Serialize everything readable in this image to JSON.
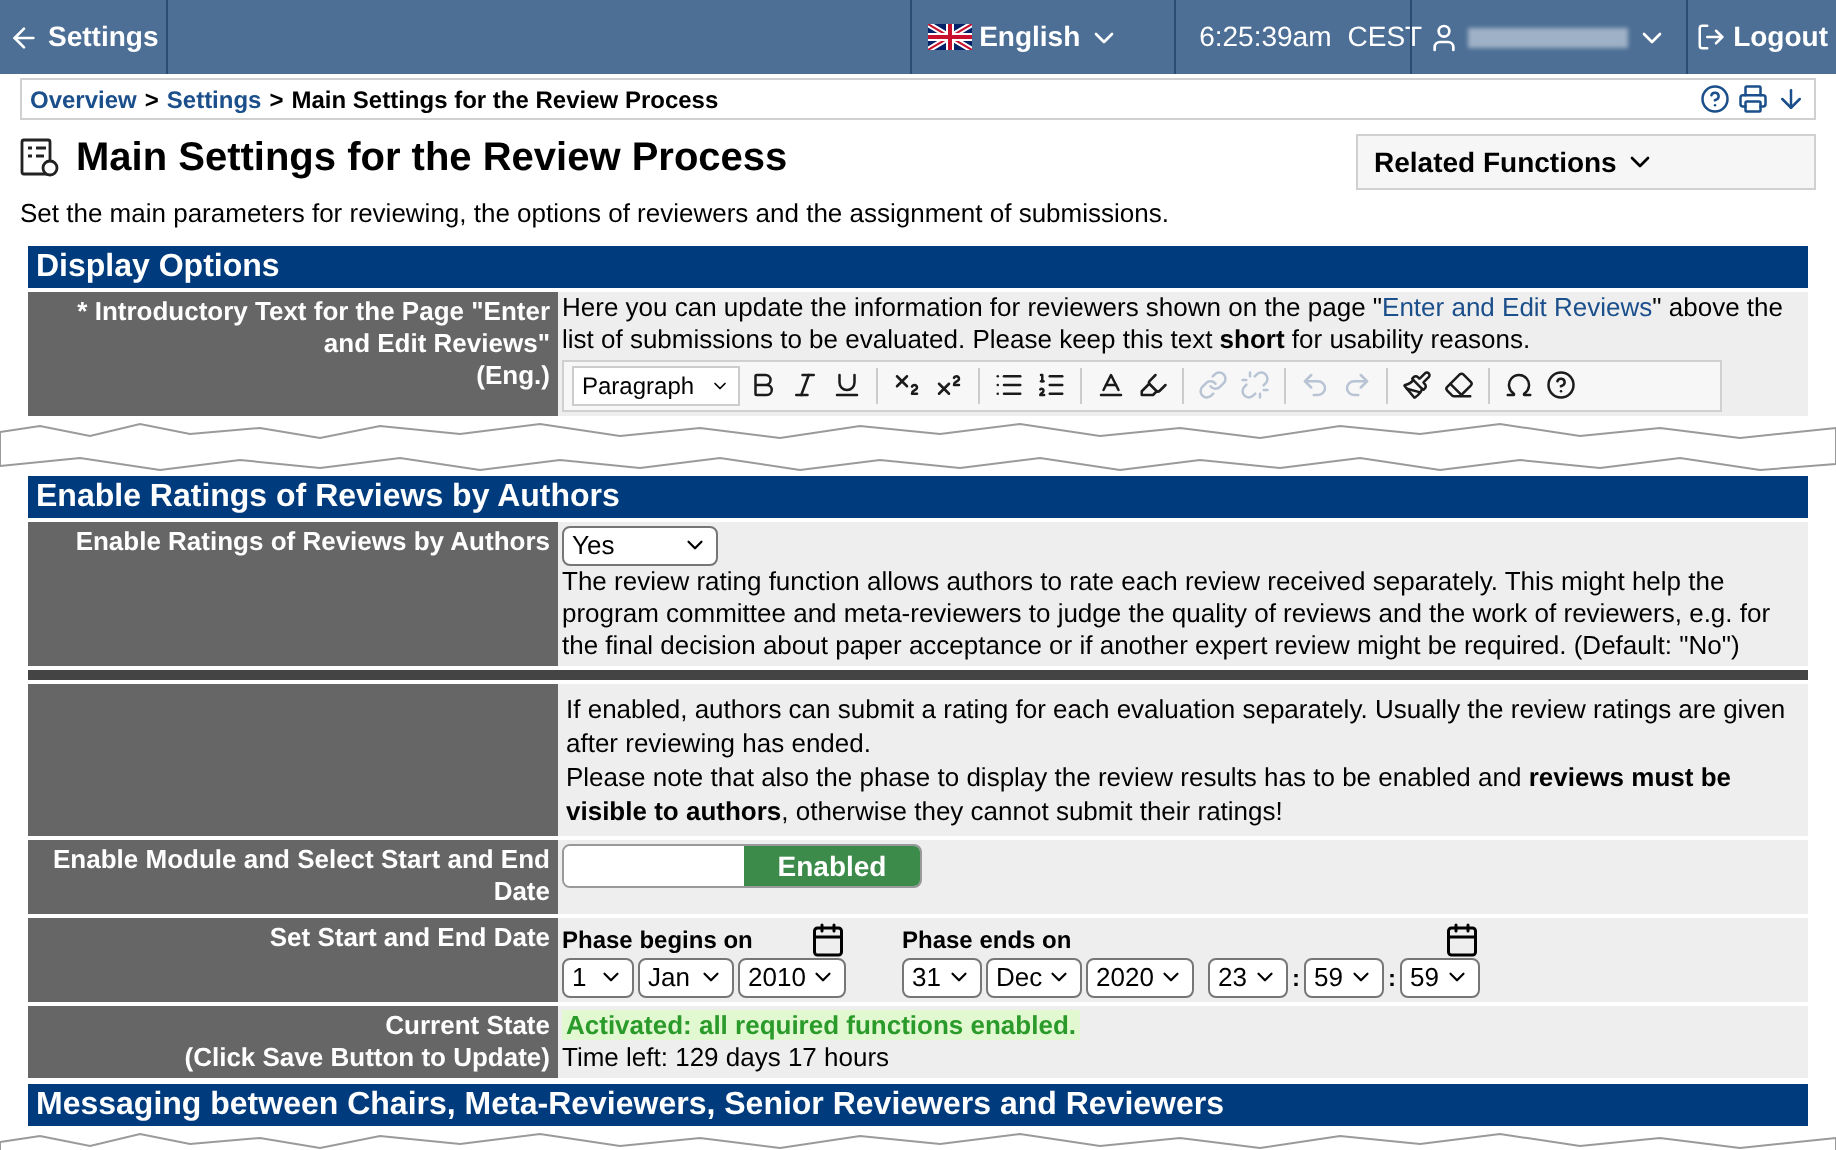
{
  "topbar": {
    "back": "Settings",
    "language": "English",
    "time": "6:25:39am",
    "timezone": "CEST",
    "logout": "Logout"
  },
  "breadcrumb": [
    {
      "label": "Overview",
      "link": true
    },
    {
      "label": "Settings",
      "link": true
    },
    {
      "label": "Main Settings for the Review Process",
      "link": false
    }
  ],
  "breadcrumb_separator": ">",
  "related": "Related Functions",
  "title": "Main Settings for the Review Process",
  "description": "Set the main parameters for reviewing, the options of reviewers and the assignment of submissions.",
  "display_options": {
    "header": "Display Options",
    "label": "* Introductory Text for the Page \"Enter and Edit Reviews\"",
    "label_note": "(Eng.)",
    "help_before": "Here you can update the information for reviewers shown on the page \"",
    "help_link": "Enter and Edit Reviews",
    "help_after": "\" above the list of submissions to be evaluated. Please keep this text **short** for usability reasons.",
    "editor": {
      "format": "Paragraph",
      "buttons": [
        {
          "kind": "bold",
          "disabled": false
        },
        {
          "kind": "italic",
          "disabled": false
        },
        {
          "kind": "underline",
          "disabled": false
        },
        {
          "kind": "sep"
        },
        {
          "kind": "subscript",
          "disabled": false
        },
        {
          "kind": "superscript",
          "disabled": false
        },
        {
          "kind": "sep"
        },
        {
          "kind": "bullets",
          "disabled": false
        },
        {
          "kind": "numbers",
          "disabled": false
        },
        {
          "kind": "sep"
        },
        {
          "kind": "textcolor",
          "disabled": false
        },
        {
          "kind": "highlight",
          "disabled": false
        },
        {
          "kind": "sep"
        },
        {
          "kind": "link",
          "disabled": true
        },
        {
          "kind": "unlink",
          "disabled": true
        },
        {
          "kind": "sep"
        },
        {
          "kind": "undo",
          "disabled": true
        },
        {
          "kind": "redo",
          "disabled": true
        },
        {
          "kind": "sep"
        },
        {
          "kind": "clean",
          "disabled": false
        },
        {
          "kind": "eraser",
          "disabled": false
        },
        {
          "kind": "sep"
        },
        {
          "kind": "omega",
          "disabled": false
        },
        {
          "kind": "help",
          "disabled": false
        }
      ]
    }
  },
  "ratings": {
    "header": "Enable Ratings of Reviews by Authors",
    "label": "Enable Ratings of Reviews by Authors",
    "value": "Yes",
    "help": "The review rating function allows authors to rate each review received separately. This might help the program committee and meta-reviewers to judge the quality of reviews and the work of reviewers, e.g. for the final decision about paper acceptance or if another expert review might be required. (Default: \"No\")",
    "info_1": "If enabled, authors can submit a rating for each evaluation separately. Usually the review ratings are given after reviewing has ended.",
    "info_2": "Please note that also the phase to display the review results has to be enabled and **reviews must be visible to authors**, otherwise they cannot submit their ratings!",
    "module_label": "Enable Module and Select Start and End Date",
    "module_toggle": {
      "label": "Enabled",
      "on": true
    },
    "dates_label": "Set Start and End Date",
    "begins": {
      "label": "Phase begins on",
      "fields": [
        "1",
        "Jan",
        "2010"
      ]
    },
    "ends": {
      "label": "Phase ends on",
      "fields": [
        "31",
        "Dec",
        "2020"
      ],
      "time": [
        "23",
        "59",
        "59"
      ],
      "time_separator": ":"
    },
    "state_label": "Current State",
    "state_note": "(Click Save Button to Update)",
    "state": "Activated: all required functions enabled.",
    "time_left": "Time left: 129 days 17 hours"
  },
  "messaging": {
    "header": "Messaging between Chairs, Meta-Reviewers, Senior Reviewers and Reviewers"
  }
}
